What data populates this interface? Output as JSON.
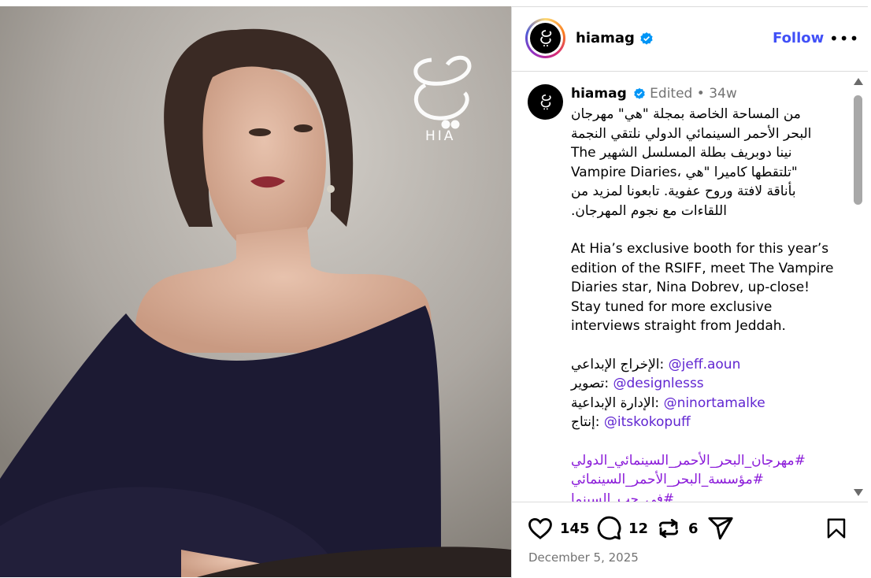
{
  "post": {
    "username": "hiamag",
    "follow_label": "Follow",
    "more_label": "•••",
    "watermark_text": "HIA",
    "caption_header": {
      "username": "hiamag",
      "edited": "Edited",
      "dot": "•",
      "age": "34w"
    },
    "caption": {
      "arabic_lines": [
        "من المساحة الخاصة بمجلة \"هي\" مهرجان",
        "البحر الأحمر السينمائي الدولي نلتقي النجمة",
        "نينا دوبريف بطلة المسلسل الشهير The",
        "Vampire Diaries، تلتقطها كاميرا \"هي\"",
        "بأناقة لافتة وروح عفوية. تابعونا لمزيد من",
        "اللقاءات مع نجوم المهرجان."
      ],
      "english_lines": [
        "At Hia’s exclusive booth for this year’s",
        "edition of the RSIFF, meet The Vampire",
        "Diaries star, Nina Dobrev, up-close!",
        "Stay tuned for more exclusive",
        "interviews straight from Jeddah."
      ],
      "credits": [
        {
          "label": "الإخراج الإبداعي:",
          "handle": "@jeff.aoun"
        },
        {
          "label": "تصوير:",
          "handle": "@designlesss"
        },
        {
          "label": "الإدارة الإبداعية:",
          "handle": "@ninortamalke"
        },
        {
          "label": "إنتاج:",
          "handle": "@itskokopuff"
        }
      ],
      "hashtags": [
        "#مهرجان_البحر_الأحمر_السينمائي_الدولي",
        "#مؤسسة_البحر_الأحمر_السينمائي",
        "#في_حب_السينما"
      ]
    },
    "actions": {
      "likes": "145",
      "comments": "12",
      "reposts": "6"
    },
    "date": "December 5, 2025"
  },
  "colors": {
    "follow": "#4150f7",
    "link": "#6126d1",
    "verified": "#0095f6"
  },
  "icons": [
    "verified-badge-icon",
    "heart-icon",
    "comment-icon",
    "repost-icon",
    "share-icon",
    "bookmark-icon",
    "more-icon"
  ]
}
